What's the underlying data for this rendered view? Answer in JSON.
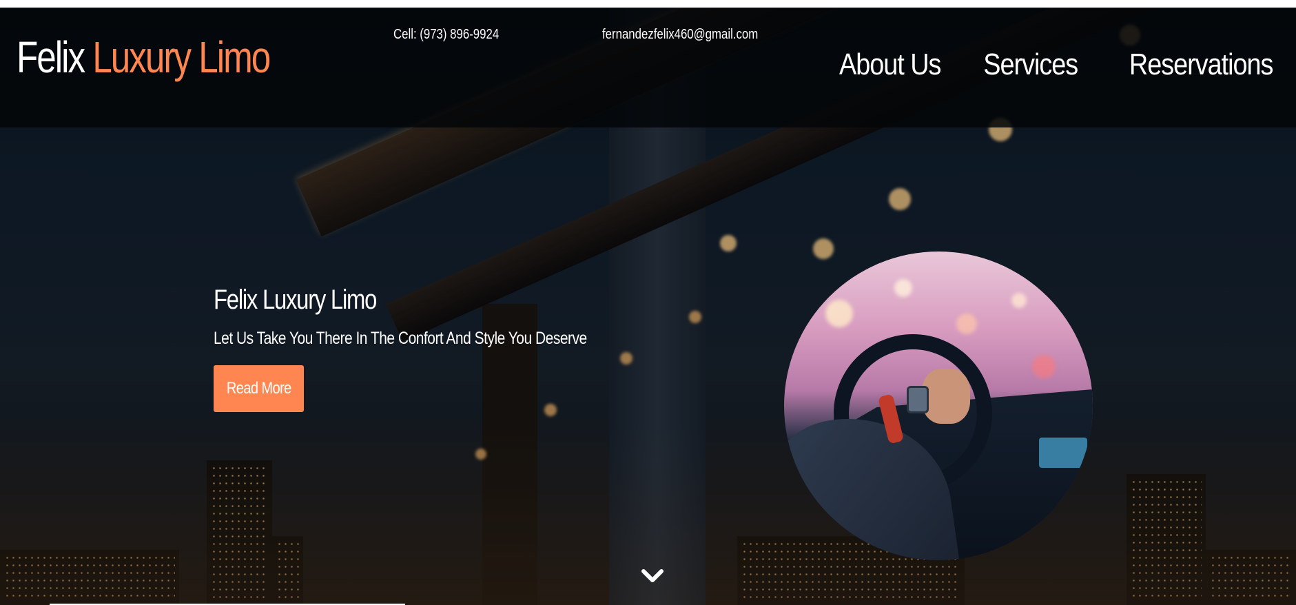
{
  "header": {
    "brand_first": "Felix",
    "brand_second": "Luxury Limo",
    "phone": "Cell: (973) 896-9924",
    "email": "fernandezfelix460@gmail.com",
    "nav": [
      {
        "label": "About Us"
      },
      {
        "label": "Services"
      },
      {
        "label": "Reservations"
      }
    ]
  },
  "hero": {
    "title": "Felix Luxury Limo",
    "subtitle": "Let Us Take You There In The Confort And Style You Deserve",
    "cta_label": "Read More"
  },
  "icons": {
    "scroll_down": "chevron-down-icon"
  },
  "colors": {
    "accent": "#ff8650",
    "header_bg": "#040608",
    "text": "#ffffff"
  }
}
